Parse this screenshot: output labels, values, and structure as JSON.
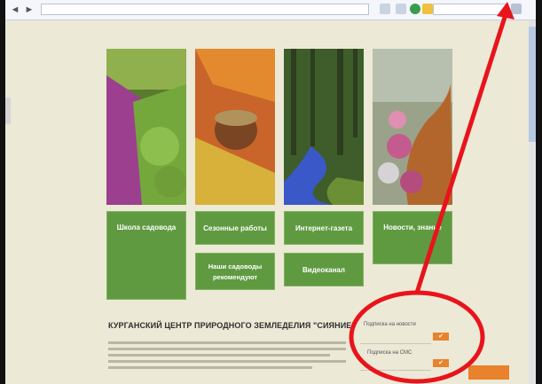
{
  "browser": {
    "back_glyph": "◄",
    "fwd_glyph": "►",
    "url": "",
    "search_placeholder": ""
  },
  "topnav": {
    "items": [
      "",
      "",
      "",
      "",
      ""
    ]
  },
  "tiles": [
    {
      "title": "Школа садовода",
      "subtitle": ""
    },
    {
      "title": "Сезонные работы"
    },
    {
      "title": "Интернет-газета"
    },
    {
      "title": "Новости, знание",
      "subtitle": ""
    },
    {
      "title": "Наши садоводы рекомендуют"
    },
    {
      "title": "Видеоканал"
    }
  ],
  "headline": "КУРГАНСКИЙ ЦЕНТР ПРИРОДНОГО ЗЕМЛЕДЕЛИЯ \"СИЯНИЕ\"",
  "subscribe": {
    "news_label": "Подписка на новости",
    "sms_label": "Подписка на СМС",
    "button_glyph": "✔"
  },
  "colors": {
    "tile_green": "#5f9a41",
    "accent_orange": "#e8822c",
    "annotation_red": "#e8141c",
    "page_bg": "#ece9d6"
  }
}
